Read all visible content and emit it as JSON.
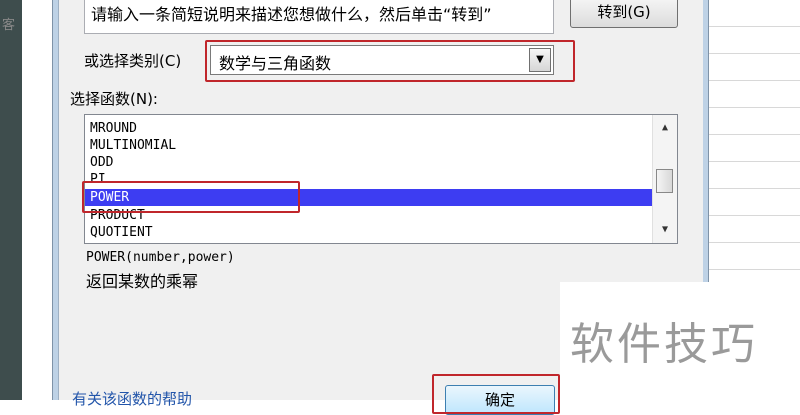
{
  "background": {
    "left_glyph": "客"
  },
  "dialog": {
    "search_description": "请输入一条简短说明来描述您想做什么，然后单击“转到”",
    "goto_button": "转到(G)",
    "category_label": "或选择类别(C)",
    "category_selected": "数学与三角函数",
    "function_label": "选择函数(N):",
    "functions": [
      "MROUND",
      "MULTINOMIAL",
      "ODD",
      "PI",
      "POWER",
      "PRODUCT",
      "QUOTIENT"
    ],
    "selected_function": "POWER",
    "syntax": "POWER(number,power)",
    "description": "返回某数的乘幂",
    "help_link": "有关该函数的帮助",
    "ok_button": "确定"
  },
  "watermark": "软件技巧",
  "colors": {
    "selection": "#3d3df2",
    "highlight_box": "#c0262b",
    "link": "#2255aa"
  }
}
